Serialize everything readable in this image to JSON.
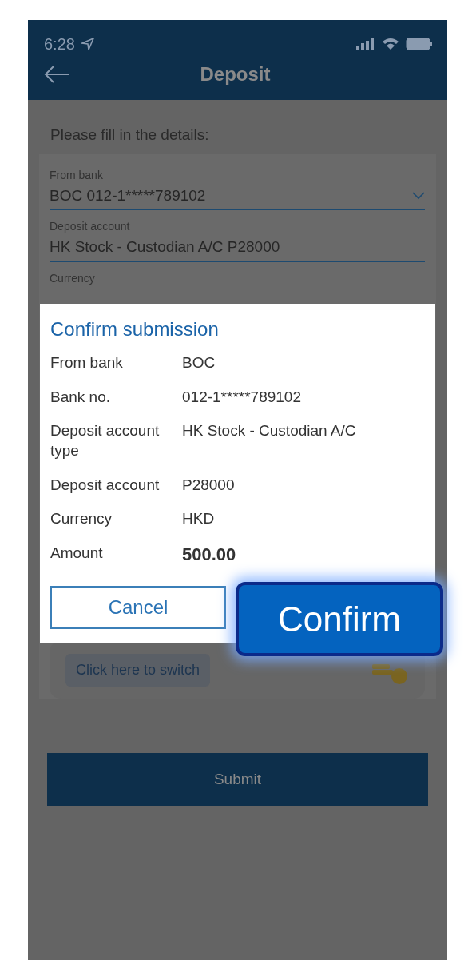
{
  "status_bar": {
    "time": "6:28"
  },
  "header": {
    "title": "Deposit"
  },
  "instruction": "Please fill in the details:",
  "form": {
    "fields": [
      {
        "label": "From bank",
        "value": "BOC 012-1*****789102",
        "kind": "dropdown"
      },
      {
        "label": "Deposit account",
        "value": "HK Stock - Custodian A/C P28000",
        "kind": "text"
      }
    ],
    "partial_label": "Currency",
    "switch_button": "Click here to switch"
  },
  "submit_button": "Submit",
  "dialog": {
    "title": "Confirm submission",
    "rows": [
      {
        "label": "From bank",
        "value": "BOC",
        "kind": "plain"
      },
      {
        "label": "Bank no.",
        "value": "012-1*****789102",
        "kind": "plain"
      },
      {
        "label": "Deposit account type",
        "value": "HK Stock - Custodian A/C",
        "kind": "plain"
      },
      {
        "label": "Deposit account",
        "value": "P28000",
        "kind": "plain"
      },
      {
        "label": "Currency",
        "value": "HKD",
        "kind": "plain"
      },
      {
        "label": "Amount",
        "value": "500.00",
        "kind": "emphasis"
      }
    ],
    "buttons": [
      {
        "label": "Cancel",
        "kind": "outline"
      },
      {
        "label": "Confirm",
        "kind": "primary"
      }
    ]
  }
}
